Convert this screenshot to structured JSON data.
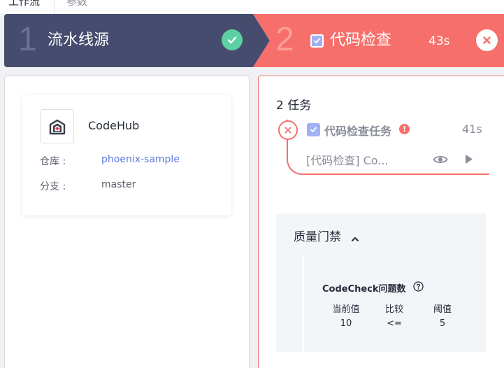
{
  "tabs": [
    {
      "label": "工作流"
    },
    {
      "label": "参数"
    }
  ],
  "stages": [
    {
      "number": "1",
      "title": "流水线源",
      "status": "success",
      "status_color": "#5cd0a2",
      "banner_color": "#464c6e"
    },
    {
      "number": "2",
      "title": "代码检查",
      "duration": "43s",
      "status": "failed",
      "banner_color": "#f66f6a"
    }
  ],
  "source": {
    "name": "CodeHub",
    "repo_label": "仓库 :",
    "repo_value": "phoenix-sample",
    "branch_label": "分支 :",
    "branch_value": "master",
    "link_color": "#5e7ce0"
  },
  "tasks": {
    "count_label": "2 任务",
    "items": [
      {
        "name": "代码检查任务",
        "duration": "41s",
        "subtitle": "[代码检查] Co...",
        "status": "failed",
        "status_color": "#f66f6a"
      }
    ]
  },
  "quality_gate": {
    "title": "质量门禁",
    "metric": "CodeCheck问题数",
    "headers": [
      "当前值",
      "比较",
      "阈值"
    ],
    "values": [
      "10",
      "<=",
      "5"
    ]
  }
}
